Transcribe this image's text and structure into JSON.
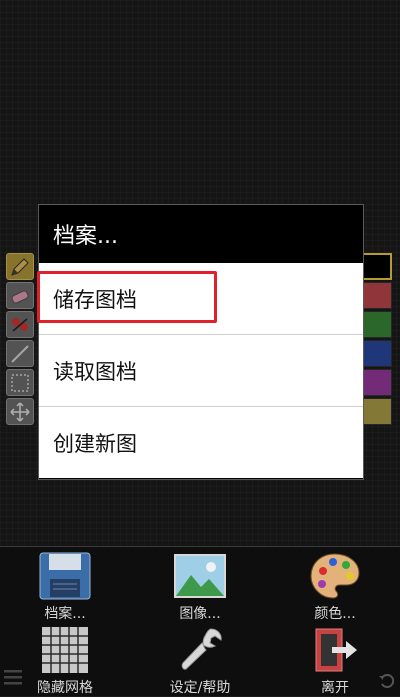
{
  "dialog": {
    "title": "档案...",
    "items": [
      {
        "label": "储存图档"
      },
      {
        "label": "读取图档"
      },
      {
        "label": "创建新图"
      }
    ]
  },
  "toolbar": {
    "buttons": [
      {
        "label": "档案...",
        "icon": "floppy-disk-icon"
      },
      {
        "label": "图像...",
        "icon": "image-icon"
      },
      {
        "label": "颜色...",
        "icon": "palette-icon"
      },
      {
        "label": "隐藏网格",
        "icon": "grid-icon"
      },
      {
        "label": "设定/帮助",
        "icon": "wrench-icon"
      },
      {
        "label": "离开",
        "icon": "exit-icon"
      }
    ]
  },
  "tools": [
    "pencil-icon",
    "eraser-icon",
    "fill-icon",
    "line-icon",
    "select-icon",
    "move-icon"
  ],
  "palette": {
    "colors": [
      "#000000",
      "#c0484e",
      "#3a8a3a",
      "#2a4aa0",
      "#9a3aa0",
      "#b0a04a"
    ]
  }
}
